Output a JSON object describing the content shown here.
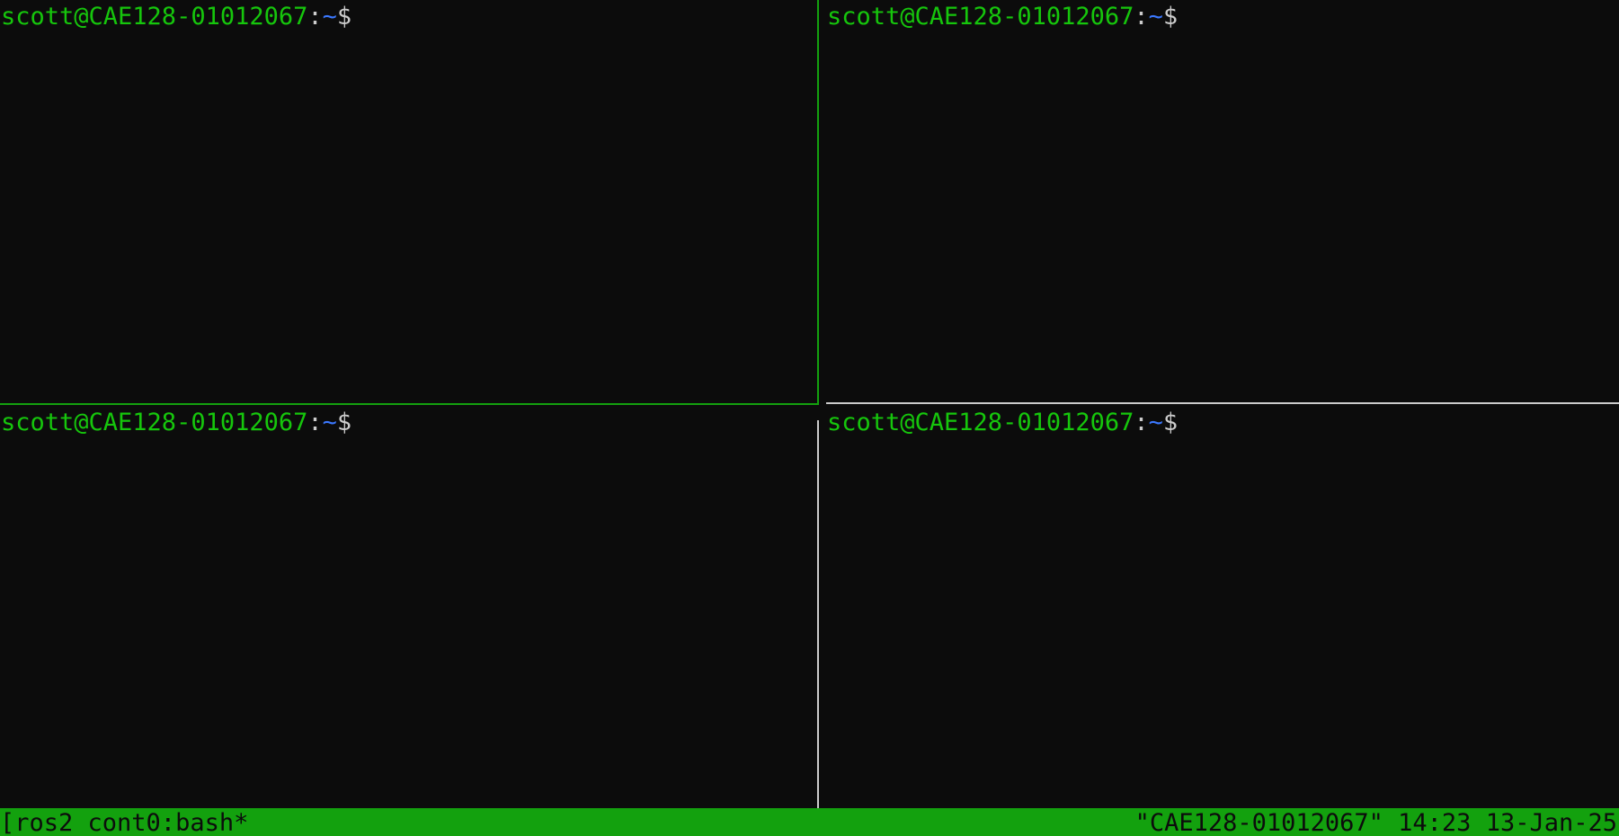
{
  "panes": [
    {
      "id": "top-left",
      "user_host": "scott@CAE128-01012067",
      "colon": ":",
      "path": "~",
      "dollar": "$"
    },
    {
      "id": "top-right",
      "user_host": "scott@CAE128-01012067",
      "colon": ":",
      "path": "~",
      "dollar": "$"
    },
    {
      "id": "bottom-left",
      "user_host": "scott@CAE128-01012067",
      "colon": ":",
      "path": "~",
      "dollar": "$"
    },
    {
      "id": "bottom-right",
      "user_host": "scott@CAE128-01012067",
      "colon": ":",
      "path": "~",
      "dollar": "$"
    }
  ],
  "status_bar": {
    "left": "[ros2 cont0:bash*",
    "right": "\"CAE128-01012067\" 14:23 13-Jan-25"
  },
  "colors": {
    "background": "#0c0c0c",
    "prompt_user": "#16c60c",
    "prompt_path": "#3b78ff",
    "prompt_text": "#cccccc",
    "active_border": "#13a10e",
    "inactive_border": "#cccccc",
    "status_bar_bg": "#13a10e"
  }
}
